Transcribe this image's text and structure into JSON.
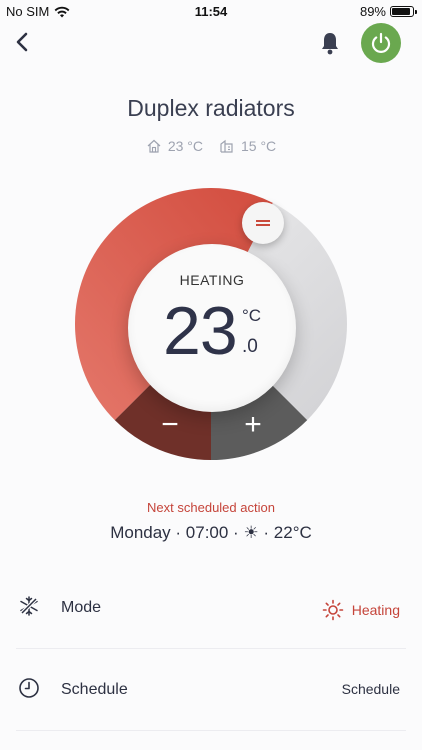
{
  "status_bar": {
    "carrier": "No SIM",
    "time": "11:54",
    "battery": "89%",
    "battery_level": 0.89
  },
  "header": {
    "title": "Duplex radiators"
  },
  "temps": {
    "indoor": "23 °C",
    "outdoor": "15 °C"
  },
  "dial": {
    "mode": "HEATING",
    "value_int": "23",
    "unit": "°C",
    "value_dec": ".0",
    "minus_label": "−",
    "plus_label": "+",
    "setpoint_fraction": 0.6,
    "colors": {
      "heat": "#d9574a",
      "track": "#dcdcde",
      "minus_bg": "#6f3029",
      "plus_bg": "#5c5c5c",
      "power": "#6aa84f"
    }
  },
  "next_action": {
    "label": "Next scheduled action",
    "value": "Monday · 07:00 · ☀ · 22°C"
  },
  "rows": {
    "mode": {
      "label": "Mode",
      "value": "Heating",
      "icon": "snowflake-sun-icon",
      "value_icon": "sun-icon"
    },
    "schedule": {
      "label": "Schedule",
      "value": "Schedule",
      "icon": "clock-icon"
    }
  }
}
